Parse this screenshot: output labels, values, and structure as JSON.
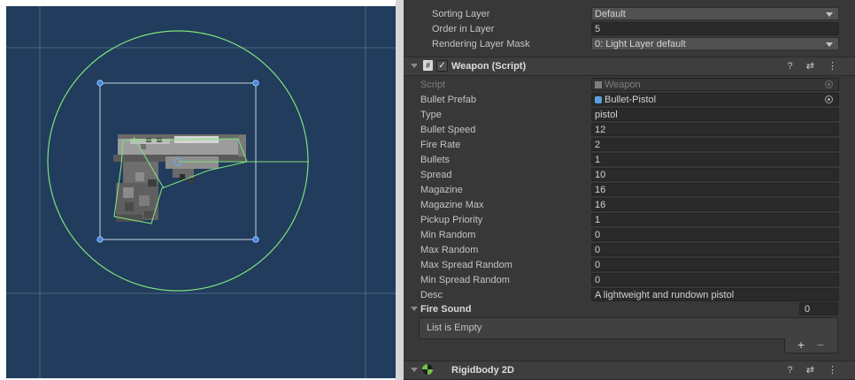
{
  "scene": {
    "background_color": "#213c5c",
    "collider_color": "#7ee07e",
    "grid_color": "#5a7896",
    "sprite_name": "pistol-sprite"
  },
  "inspector": {
    "top_props": [
      {
        "label": "Sorting Layer",
        "value": "Default",
        "kind": "dropdown"
      },
      {
        "label": "Order in Layer",
        "value": "5",
        "kind": "field"
      },
      {
        "label": "Rendering Layer Mask",
        "value": "0: Light Layer default",
        "kind": "dropdown"
      }
    ],
    "weapon": {
      "title": "Weapon (Script)",
      "enabled": true,
      "icons": [
        "help-icon",
        "presets-icon",
        "more-menu-icon"
      ],
      "icon_glyphs": "? ⇄ ⋮",
      "script": {
        "label": "Script",
        "value": "Weapon"
      },
      "bullet_prefab": {
        "label": "Bullet Prefab",
        "value": "Bullet-Pistol"
      },
      "fields": [
        {
          "label": "Type",
          "value": "pistol"
        },
        {
          "label": "Bullet Speed",
          "value": "12"
        },
        {
          "label": "Fire Rate",
          "value": "2"
        },
        {
          "label": "Bullets",
          "value": "1"
        },
        {
          "label": "Spread",
          "value": "10"
        },
        {
          "label": "Magazine",
          "value": "16"
        },
        {
          "label": "Magazine Max",
          "value": "16"
        },
        {
          "label": "Pickup Priority",
          "value": "1"
        },
        {
          "label": "Min Random",
          "value": "0"
        },
        {
          "label": "Max Random",
          "value": "0"
        },
        {
          "label": "Max Spread Random",
          "value": "0"
        },
        {
          "label": "Min Spread Random",
          "value": "0"
        },
        {
          "label": "Desc",
          "value": "A lightweight and rundown pistol"
        }
      ],
      "fire_sound": {
        "label": "Fire Sound",
        "size": "0",
        "empty_text": "List is Empty",
        "add_label": "+",
        "remove_label": "−"
      }
    },
    "rigidbody": {
      "title": "Rigidbody 2D",
      "icon_glyphs": "? ⇄ ⋮"
    }
  }
}
